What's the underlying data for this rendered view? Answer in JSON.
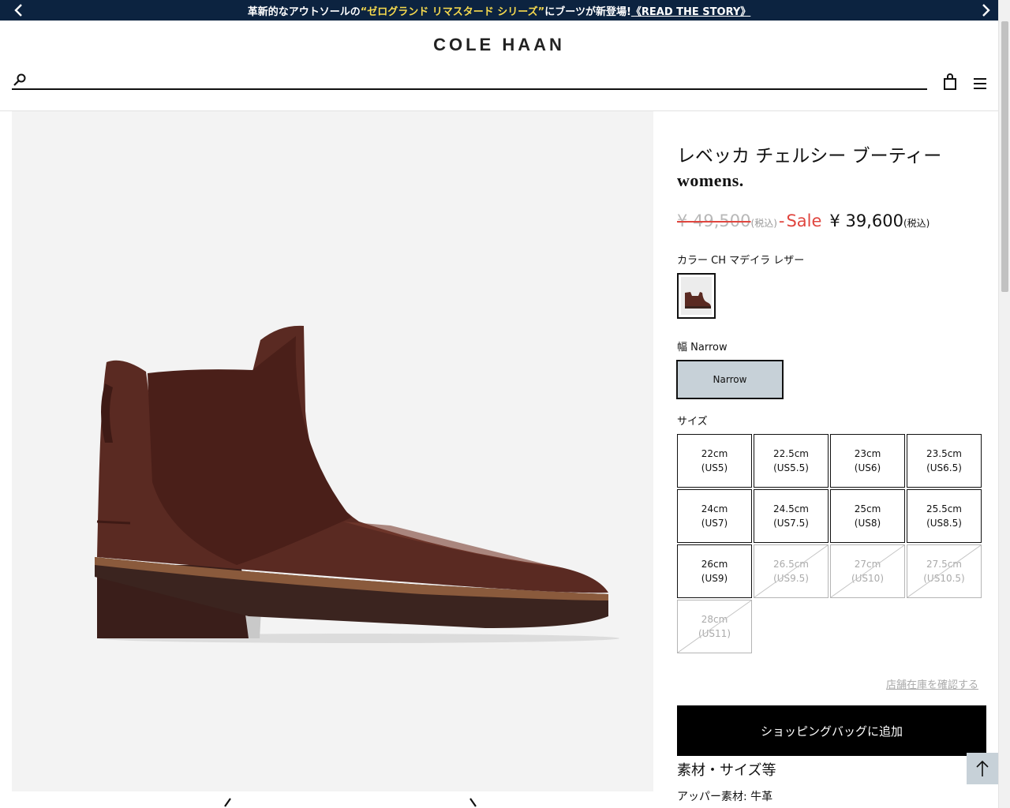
{
  "announcement": {
    "pre": "革新的なアウトソールの",
    "highlight": "“ゼログランド リマスタード シリーズ”",
    "post": " にブーツが新登場!",
    "link": "《READ THE STORY》"
  },
  "header": {
    "logo": "COLE HAAN",
    "search_placeholder": ""
  },
  "product": {
    "title": "レベッカ チェルシー ブーティー",
    "subtitle": "womens.",
    "original_price": "¥ 49,500",
    "original_tax": "(税込)",
    "sale_sep": "- ",
    "sale_label": "Sale",
    "sale_price": "¥ 39,600",
    "sale_tax": "(税込)",
    "color_label": "カラー CH マデイラ レザー",
    "width_label": "幅 Narrow",
    "width_option": "Narrow",
    "size_label": "サイズ",
    "sizes": [
      {
        "cm": "22cm",
        "us": "(US5)",
        "available": true
      },
      {
        "cm": "22.5cm",
        "us": "(US5.5)",
        "available": true
      },
      {
        "cm": "23cm",
        "us": "(US6)",
        "available": true
      },
      {
        "cm": "23.5cm",
        "us": "(US6.5)",
        "available": true
      },
      {
        "cm": "24cm",
        "us": "(US7)",
        "available": true
      },
      {
        "cm": "24.5cm",
        "us": "(US7.5)",
        "available": true
      },
      {
        "cm": "25cm",
        "us": "(US8)",
        "available": true
      },
      {
        "cm": "25.5cm",
        "us": "(US8.5)",
        "available": true
      },
      {
        "cm": "26cm",
        "us": "(US9)",
        "available": true
      },
      {
        "cm": "26.5cm",
        "us": "(US9.5)",
        "available": false
      },
      {
        "cm": "27cm",
        "us": "(US10)",
        "available": false
      },
      {
        "cm": "27.5cm",
        "us": "(US10.5)",
        "available": false
      },
      {
        "cm": "28cm",
        "us": "(US11)",
        "available": false
      }
    ],
    "store_stock_link": "店舗在庫を確認する",
    "add_to_bag": "ショッピングバッグに追加",
    "specs_title": "素材・サイズ等",
    "upper_material": "アッパー素材: 牛革"
  },
  "colors": {
    "announce_bg": "#0c2340",
    "highlight": "#f5d94e",
    "sale_red": "#e0463f",
    "selected_bg": "#c7d1d8",
    "boot_brown": "#5a2a22"
  }
}
